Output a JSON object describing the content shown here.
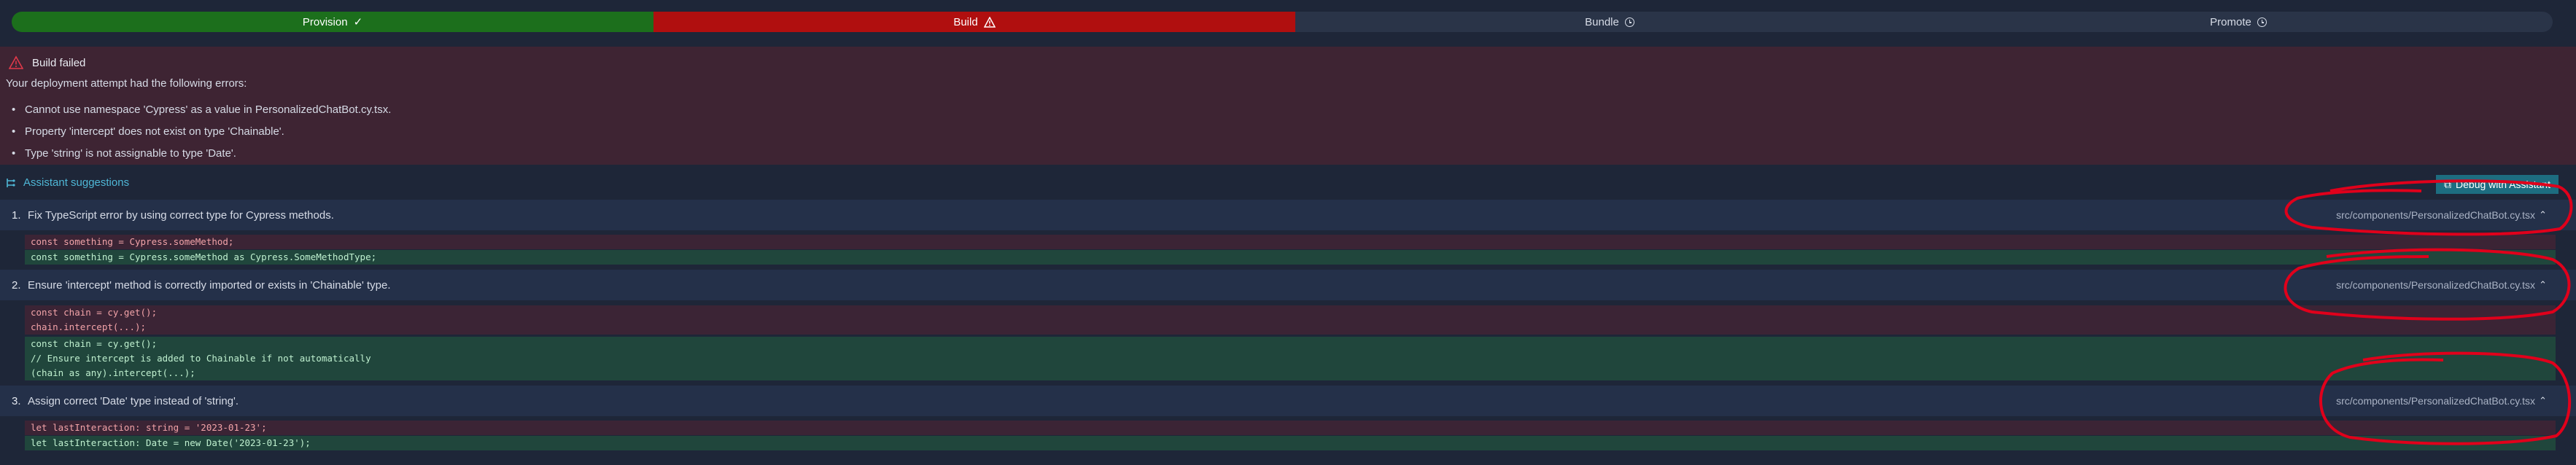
{
  "pipeline": {
    "steps": [
      {
        "label": "Provision",
        "status": "done",
        "icon": "check-icon"
      },
      {
        "label": "Build",
        "status": "failed",
        "icon": "warning-icon"
      },
      {
        "label": "Bundle",
        "status": "pending",
        "icon": "clock-icon"
      },
      {
        "label": "Promote",
        "status": "pending",
        "icon": "clock-icon"
      }
    ]
  },
  "error_panel": {
    "title": "Build failed",
    "intro": "Your deployment attempt had the following errors:",
    "errors": [
      "Cannot use namespace 'Cypress' as a value in PersonalizedChatBot.cy.tsx.",
      "Property 'intercept' does not exist on type 'Chainable'.",
      "Type 'string' is not assignable to type 'Date'."
    ]
  },
  "assistant": {
    "header": "Assistant suggestions",
    "debug_button": "Debug with Assistant",
    "suggestions": [
      {
        "number": "1.",
        "text": "Fix TypeScript error by using correct type for Cypress methods.",
        "path": "src/components/PersonalizedChatBot.cy.tsx",
        "removed": [
          "const something = Cypress.someMethod;"
        ],
        "added": [
          "const something = Cypress.someMethod as Cypress.SomeMethodType;"
        ]
      },
      {
        "number": "2.",
        "text": "Ensure 'intercept' method is correctly imported or exists in 'Chainable' type.",
        "path": "src/components/PersonalizedChatBot.cy.tsx",
        "removed": [
          "const chain = cy.get();",
          "chain.intercept(...);"
        ],
        "added": [
          "const chain = cy.get();",
          "// Ensure intercept is added to Chainable if not automatically",
          "(chain as any).intercept(...);"
        ]
      },
      {
        "number": "3.",
        "text": "Assign correct 'Date' type instead of 'string'.",
        "path": "src/components/PersonalizedChatBot.cy.tsx",
        "removed": [
          "let lastInteraction: string = '2023-01-23';"
        ],
        "added": [
          "let lastInteraction: Date = new Date('2023-01-23');"
        ]
      }
    ]
  },
  "colors": {
    "done": "#1c6f1c",
    "failed": "#b00f0f",
    "pending": "#2a3448",
    "accent": "#4fb7d6",
    "annotation": "#e0001b"
  }
}
